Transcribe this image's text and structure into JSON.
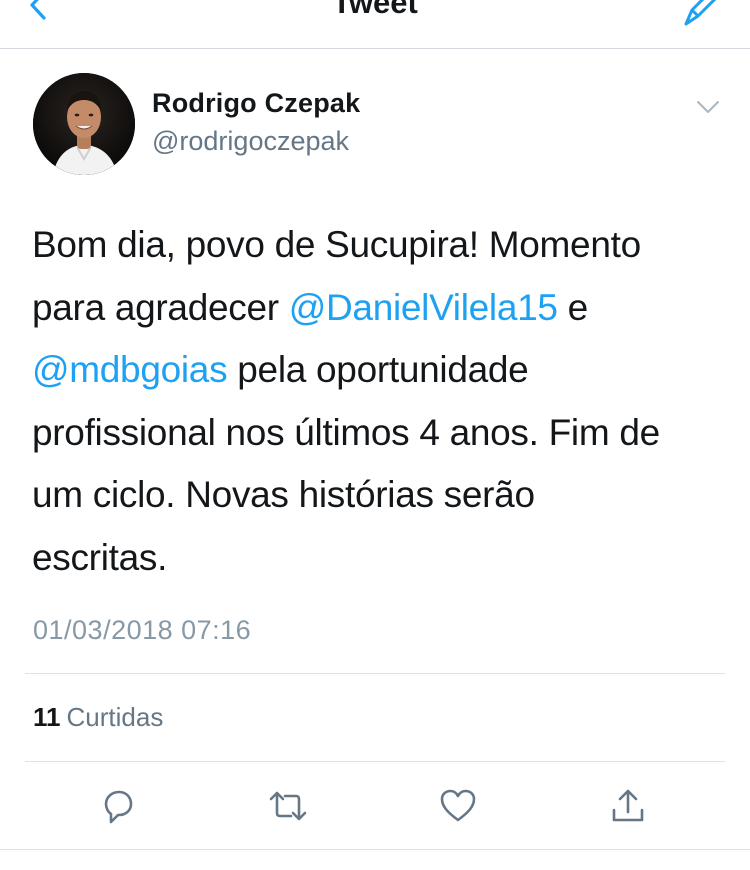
{
  "nav": {
    "title": "Tweet",
    "back_icon": "chevron-left-icon",
    "compose_icon": "compose-tweet-icon"
  },
  "author": {
    "name": "Rodrigo Czepak",
    "handle": "@rodrigoczepak"
  },
  "tweet": {
    "lines": [
      [
        {
          "text": "Bom dia, povo de Sucupira! Momento",
          "mention": false
        }
      ],
      [
        {
          "text": "para agradecer ",
          "mention": false
        },
        {
          "text": "@DanielVilela15",
          "mention": true
        },
        {
          "text": " e",
          "mention": false
        }
      ],
      [
        {
          "text": "@mdbgoias",
          "mention": true
        },
        {
          "text": " pela oportunidade",
          "mention": false
        }
      ],
      [
        {
          "text": "profissional nos últimos 4 anos. Fim de",
          "mention": false
        }
      ],
      [
        {
          "text": "um ciclo. Novas histórias serão",
          "mention": false
        }
      ],
      [
        {
          "text": "escritas.",
          "mention": false
        }
      ]
    ],
    "timestamp": "01/03/2018 07:16"
  },
  "stats": {
    "likes_count": "11",
    "likes_label": "Curtidas"
  },
  "actions": [
    "reply-icon",
    "retweet-icon",
    "like-icon",
    "share-icon"
  ],
  "colors": {
    "accent": "#1da1f2",
    "text": "#14171a",
    "secondary": "#657786",
    "timestamp": "#8899a6",
    "divider": "#dfe3e8"
  }
}
